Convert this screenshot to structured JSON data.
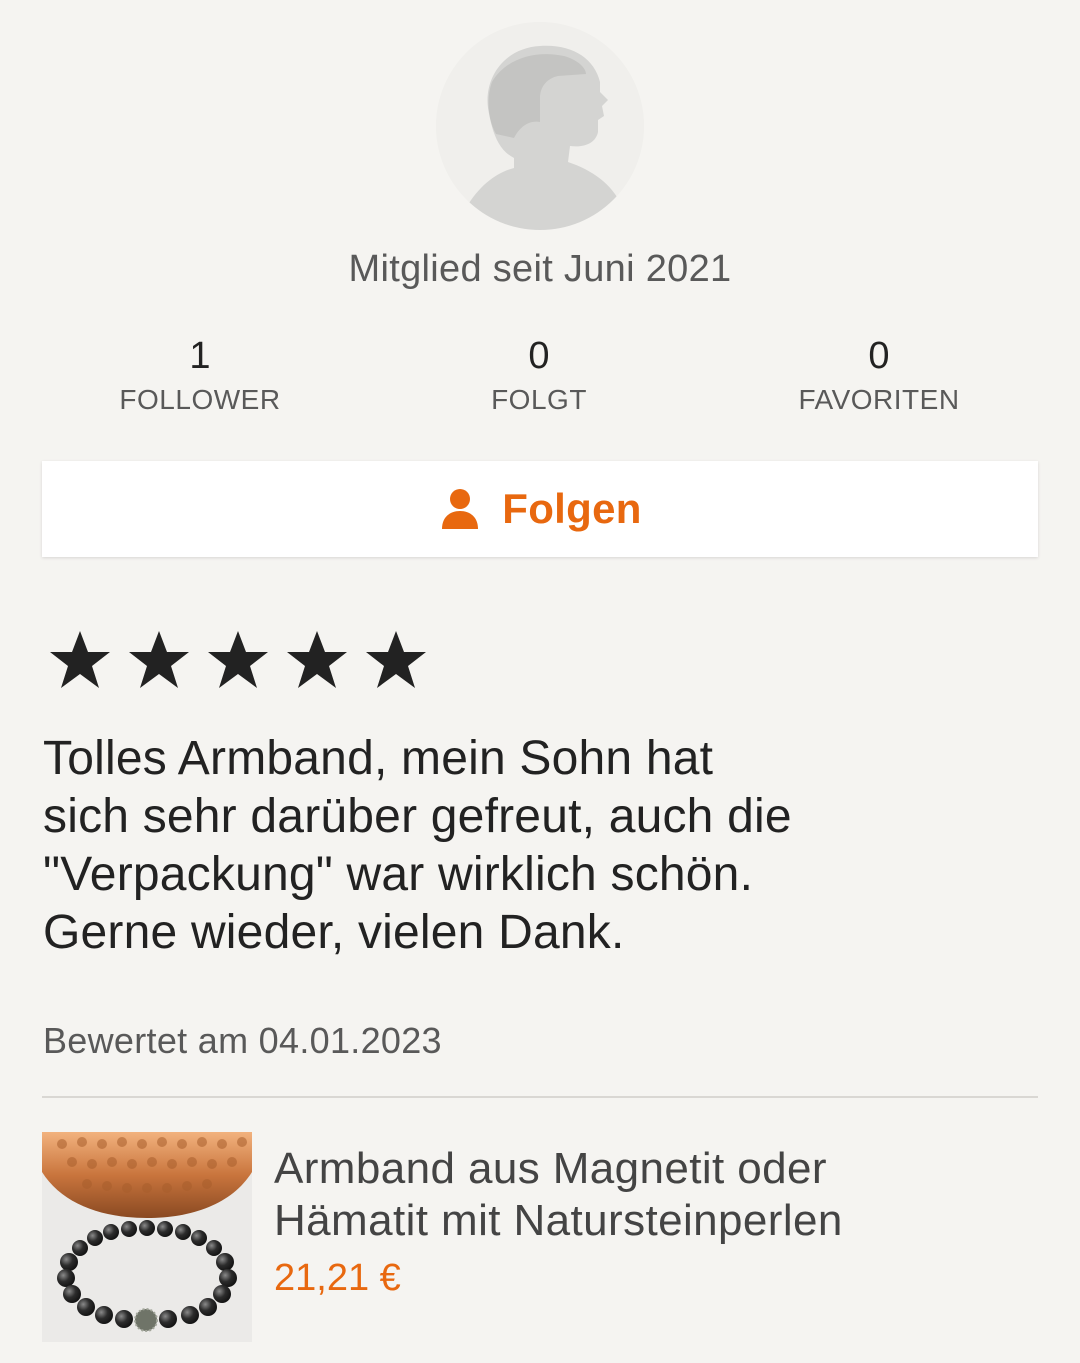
{
  "profile": {
    "avatar_icon": "default-user-avatar-icon",
    "member_since": "Mitglied seit Juni 2021",
    "stats": {
      "followers": {
        "value": "1",
        "label": "FOLLOWER"
      },
      "following": {
        "value": "0",
        "label": "FOLGT"
      },
      "favorites": {
        "value": "0",
        "label": "FAVORITEN"
      }
    },
    "follow_button": {
      "label": "Folgen",
      "icon": "user-icon"
    }
  },
  "review": {
    "rating": 5,
    "max_rating": 5,
    "text": "Tolles Armband, mein Sohn hat\nsich sehr darüber gefreut, auch die\n\"Verpackung\" war wirklich schön.\nGerne wieder, vielen Dank.",
    "date": "Bewertet am 04.01.2023"
  },
  "product": {
    "title": "Armband aus Magnetit oder\nHämatit mit Natursteinperlen",
    "price": "21,21 €"
  },
  "colors": {
    "accent": "#e8680f",
    "background": "#f5f4f1",
    "text_primary": "#222222",
    "text_secondary": "#595959"
  }
}
